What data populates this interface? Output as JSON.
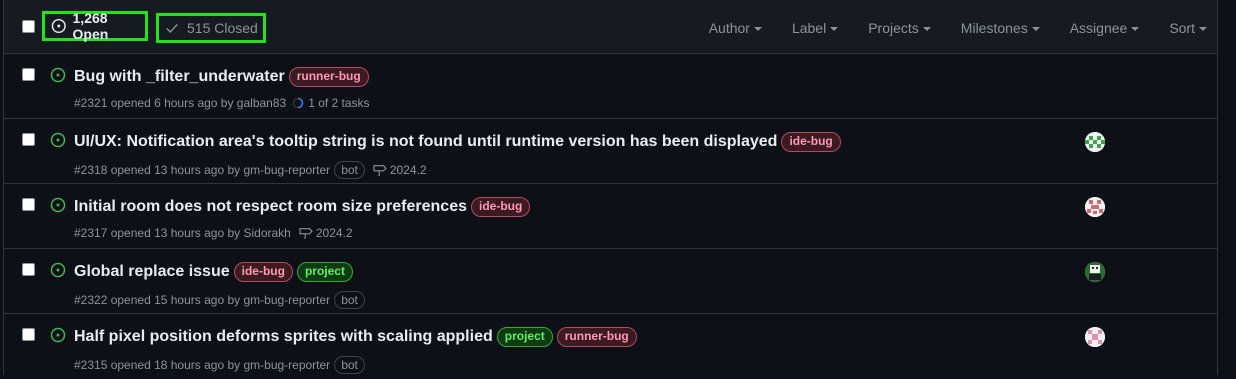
{
  "header": {
    "open_label": "1,268 Open",
    "closed_label": "515 Closed",
    "filters": [
      "Author",
      "Label",
      "Projects",
      "Milestones",
      "Assignee",
      "Sort"
    ]
  },
  "colors": {
    "background": "#0d1117",
    "header_bg": "#161b22",
    "open_icon": "#3fb950",
    "highlight_box": "#22e21a",
    "label_red_text": "#ff9ab0",
    "label_green_text": "#5ef05e"
  },
  "issues": [
    {
      "title": "Bug with _filter_underwater",
      "labels": [
        "runner-bug"
      ],
      "meta": "#2321 opened 6 hours ago by galban83",
      "tasks": "1 of 2 tasks"
    },
    {
      "title": "UI/UX: Notification area's tooltip string is not found until runtime version has been displayed",
      "labels": [
        "ide-bug"
      ],
      "meta": "#2318 opened 13 hours ago by gm-bug-reporter",
      "bot": "bot",
      "milestone": "2024.2",
      "avatar": "green-checker-avatar"
    },
    {
      "title": "Initial room does not respect room size preferences",
      "labels": [
        "ide-bug"
      ],
      "meta": "#2317 opened 13 hours ago by Sidorakh",
      "milestone": "2024.2",
      "avatar": "red-checker-avatar"
    },
    {
      "title": "Global replace issue",
      "labels": [
        "ide-bug",
        "project"
      ],
      "meta": "#2322 opened 15 hours ago by gm-bug-reporter",
      "bot": "bot",
      "avatar": "dark-green-avatar"
    },
    {
      "title": "Half pixel position deforms sprites with scaling applied",
      "labels": [
        "project",
        "runner-bug"
      ],
      "meta": "#2315 opened 18 hours ago by gm-bug-reporter",
      "bot": "bot",
      "avatar": "pink-checker-avatar"
    }
  ]
}
